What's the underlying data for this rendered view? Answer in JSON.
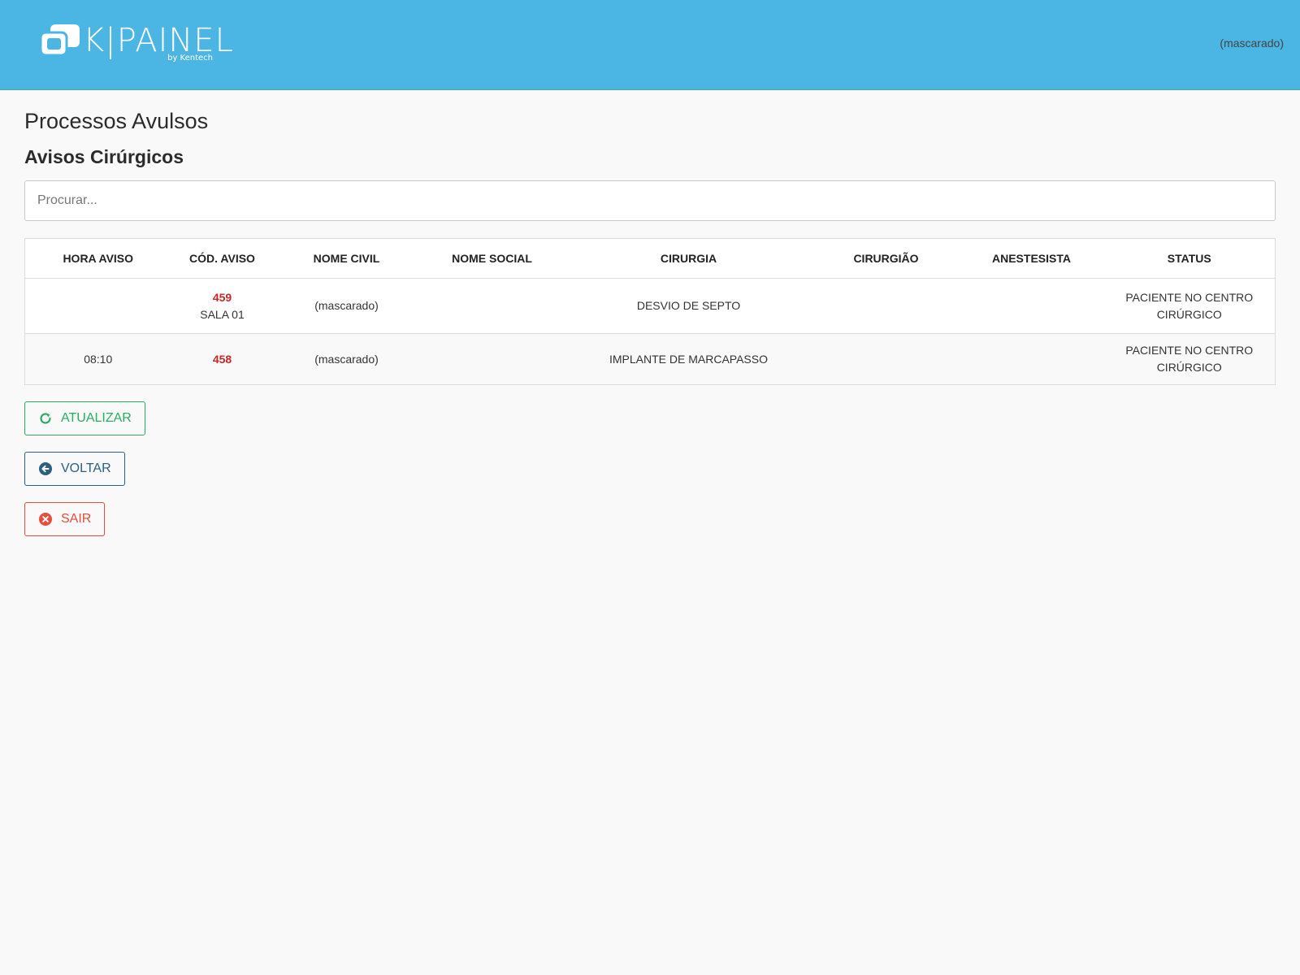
{
  "header": {
    "logo_text": "K|PAINEL",
    "logo_byline": "by Kentech",
    "user": "(mascarado)"
  },
  "page": {
    "title": "Processos Avulsos",
    "section_title": "Avisos Cirúrgicos"
  },
  "search": {
    "placeholder": "Procurar...",
    "value": ""
  },
  "table": {
    "columns": [
      "HORA AVISO",
      "CÓD. AVISO",
      "NOME CIVIL",
      "NOME SOCIAL",
      "CIRURGIA",
      "CIRURGIÃO",
      "ANESTESISTA",
      "STATUS"
    ],
    "rows": [
      {
        "hora_aviso": "",
        "cod_aviso": "459",
        "sala": "SALA 01",
        "nome_civil": "(mascarado)",
        "nome_social": "",
        "cirurgia": "DESVIO DE SEPTO",
        "cirurgiao": "",
        "anestesista": "",
        "status": "PACIENTE NO CENTRO CIRÚRGICO"
      },
      {
        "hora_aviso": "08:10",
        "cod_aviso": "458",
        "sala": "",
        "nome_civil": "(mascarado)",
        "nome_social": "",
        "cirurgia": "IMPLANTE DE MARCAPASSO",
        "cirurgiao": "",
        "anestesista": "",
        "status": "PACIENTE NO CENTRO CIRÚRGICO"
      }
    ]
  },
  "buttons": {
    "update": {
      "label": "ATUALIZAR",
      "icon": "refresh-icon",
      "color": "#27ae60"
    },
    "back": {
      "label": "VOLTAR",
      "icon": "arrow-left-circle-icon",
      "color": "#2c5f80"
    },
    "exit": {
      "label": "SAIR",
      "icon": "close-circle-icon",
      "color": "#e74c3c"
    }
  },
  "colors": {
    "header_bg": "#4bb5e3",
    "page_bg": "#f9f9f9",
    "code_red": "#c62828"
  }
}
